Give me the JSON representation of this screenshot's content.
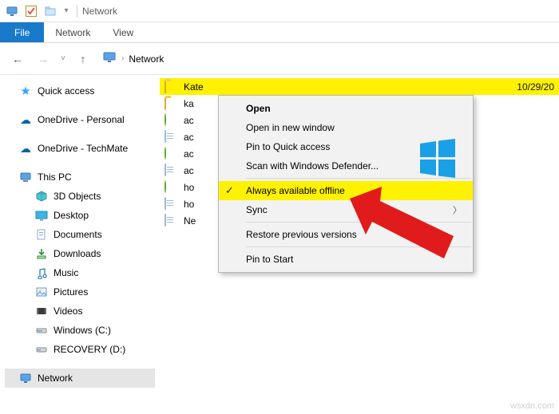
{
  "window": {
    "title": "Network"
  },
  "ribbon": {
    "file": "File",
    "tabs": [
      "Network",
      "View"
    ]
  },
  "nav": {
    "crumb": "Network"
  },
  "sidebar": {
    "quick_access": "Quick access",
    "onedrive_personal": "OneDrive - Personal",
    "onedrive_techmate": "OneDrive - TechMate",
    "this_pc": "This PC",
    "children": [
      "3D Objects",
      "Desktop",
      "Documents",
      "Downloads",
      "Music",
      "Pictures",
      "Videos",
      "Windows (C:)",
      "RECOVERY (D:)"
    ],
    "network": "Network"
  },
  "rows": {
    "selected": {
      "name": "Kate",
      "date": "10/29/20"
    },
    "items": [
      "ka",
      "ac",
      "ac",
      "ac",
      "ac",
      "ho",
      "ho",
      "Ne"
    ]
  },
  "ctx": {
    "open": "Open",
    "open_new": "Open in new window",
    "pin_quick": "Pin to Quick access",
    "scan": "Scan with Windows Defender...",
    "offline": "Always available offline",
    "sync": "Sync",
    "restore": "Restore previous versions",
    "pin_start": "Pin to Start"
  },
  "watermark": "wsxdn.com"
}
